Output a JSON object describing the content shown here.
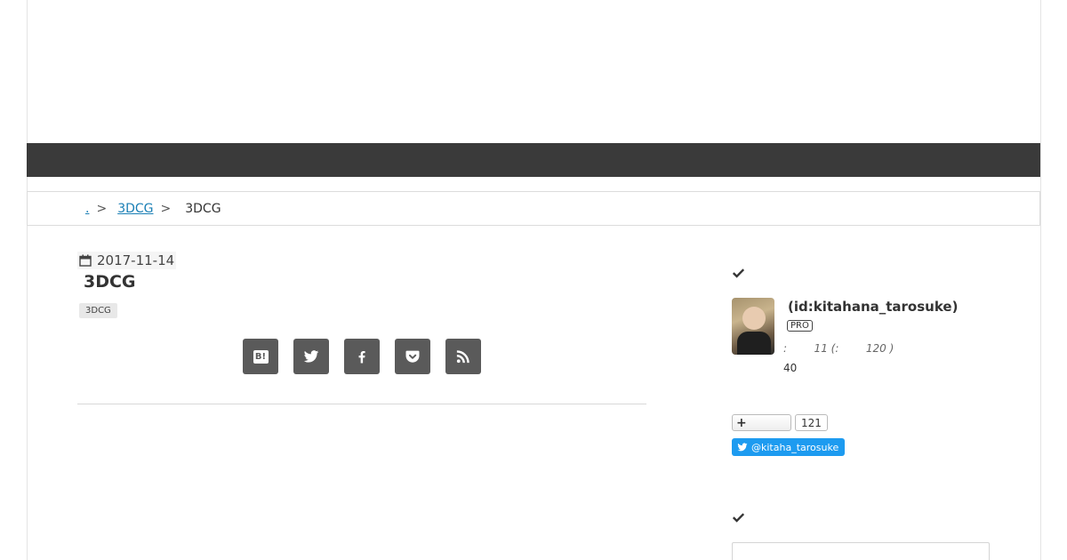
{
  "breadcrumb": {
    "home_label": ".",
    "category_label": "3DCG",
    "separator": ">",
    "current_label": "3DCG"
  },
  "entry": {
    "date": "2017-11-14",
    "title": "3DCG",
    "tag": "3DCG"
  },
  "share": {
    "hatena_label": "B!",
    "buttons": [
      "hatena-bookmark",
      "twitter",
      "facebook",
      "pocket",
      "rss"
    ]
  },
  "sidebar": {
    "profile": {
      "id_label": "(id:kitahana_tarosuke)",
      "pro_badge": "PRO",
      "stats": ":        11 (:        120 )",
      "count": "40"
    },
    "follow": {
      "plus_label": "+",
      "count": "121"
    },
    "twitter": {
      "handle": "@kitaha_tarosuke"
    }
  },
  "colors": {
    "nav_bar": "#3a3a3a",
    "share_button": "#5a5a5a",
    "twitter_blue": "#1d9bf0",
    "link": "#1a7fb5"
  }
}
